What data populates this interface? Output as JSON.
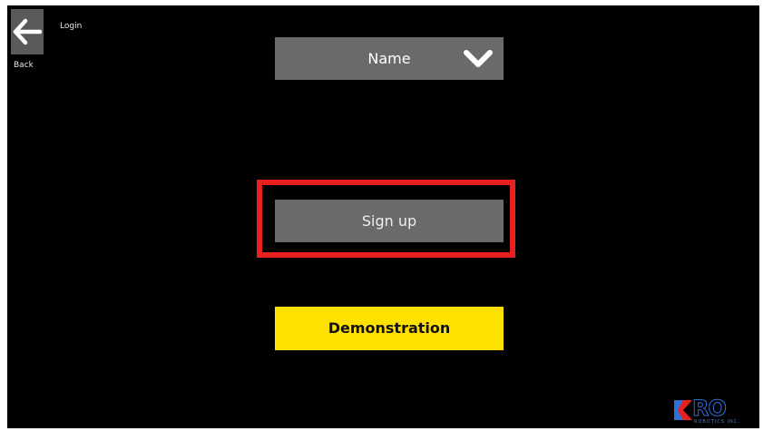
{
  "header": {
    "back_label": "Back",
    "screen_title": "Login"
  },
  "form": {
    "name_dropdown": {
      "selected_value": "Name",
      "icon": "chevron-down-icon"
    },
    "signup_label": "Sign up",
    "demo_label": "Demonstration"
  },
  "logo": {
    "text": "RO",
    "subtext": "ROBOTICS INC."
  },
  "colors": {
    "background": "#000000",
    "button_gray": "#6a6a6a",
    "demo_yellow": "#ffe100",
    "highlight_red": "#e8211f",
    "logo_blue": "#2f6fdc"
  }
}
